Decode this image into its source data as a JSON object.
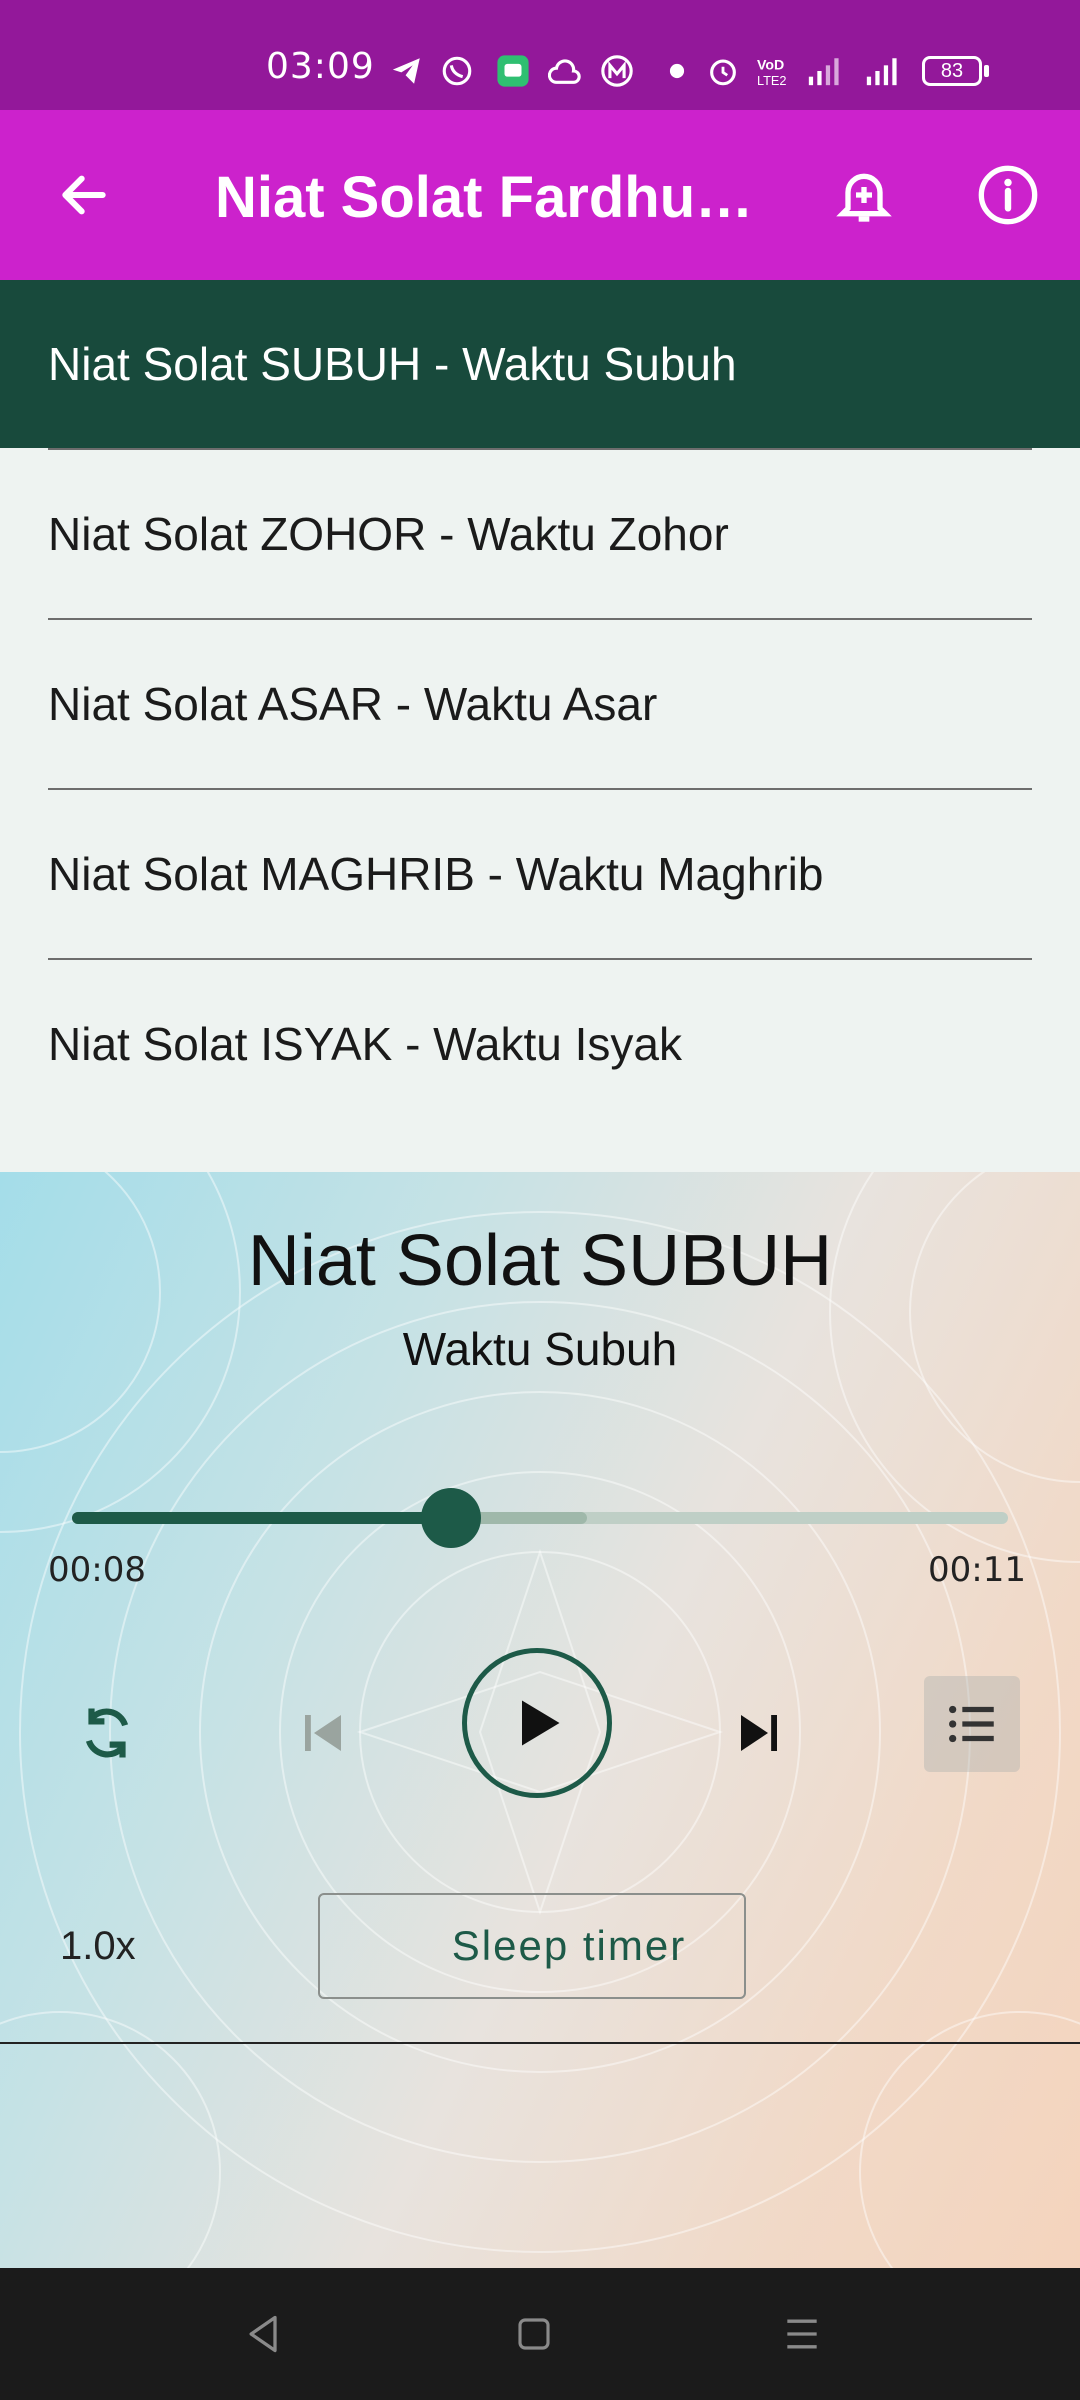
{
  "status_bar": {
    "time": "03:09",
    "battery": "83",
    "icons": [
      "telegram-icon",
      "whatsapp-icon",
      "messages-icon",
      "cloud-icon",
      "m-app-icon",
      "dot-icon",
      "alarm-icon",
      "volte-icon",
      "signal-icon",
      "signal-icon",
      "battery-icon"
    ]
  },
  "app_bar": {
    "title": "Niat Solat Fardhu …",
    "back_icon": "arrow-left-icon",
    "reminder_icon": "bell-plus-icon",
    "info_icon": "info-icon"
  },
  "playlist": [
    {
      "label": "Niat Solat SUBUH - Waktu Subuh",
      "active": true
    },
    {
      "label": "Niat Solat ZOHOR - Waktu Zohor",
      "active": false
    },
    {
      "label": "Niat Solat ASAR - Waktu Asar",
      "active": false
    },
    {
      "label": "Niat Solat MAGHRIB - Waktu Maghrib",
      "active": false
    },
    {
      "label": "Niat Solat ISYAK - Waktu Isyak",
      "active": false
    }
  ],
  "player": {
    "title": "Niat Solat SUBUH",
    "subtitle": "Waktu Subuh",
    "position": "00:08",
    "duration": "00:11",
    "progress_fraction": 0.405,
    "buffered_fraction": 0.55,
    "speed": "1.0x",
    "sleep_timer_label": "Sleep timer",
    "accent_color": "#1d5a48"
  },
  "colors": {
    "status_bar": "#93189a",
    "app_bar": "#cc22cc",
    "active_item": "#184a3c",
    "list_background": "#eef3f1"
  },
  "nav_bar": {
    "icons": [
      "back-triangle-icon",
      "home-square-icon",
      "menu-lines-icon"
    ]
  }
}
